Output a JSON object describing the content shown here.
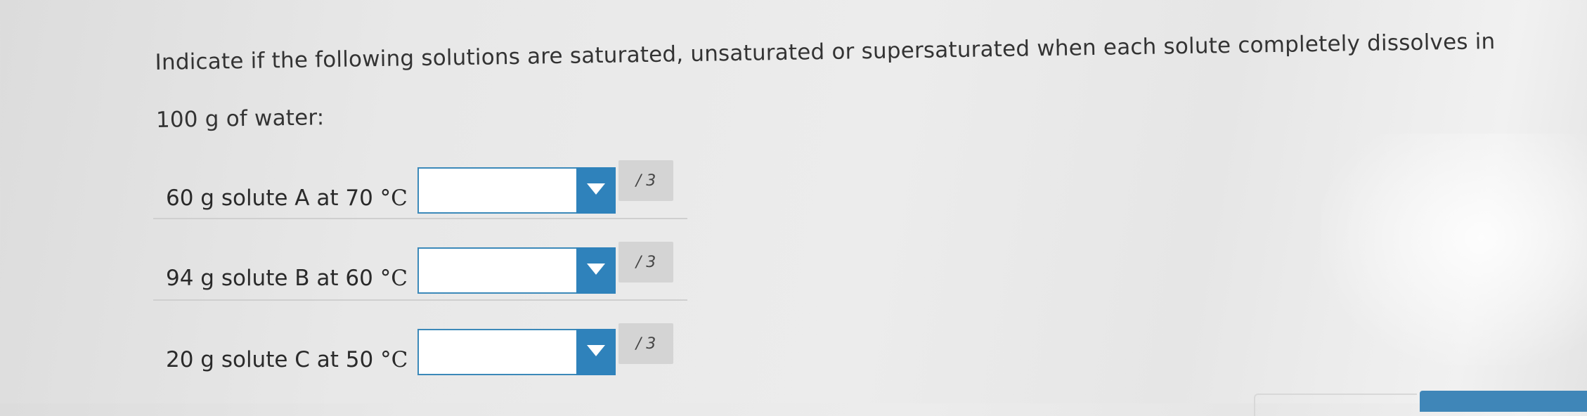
{
  "question": {
    "text": "Indicate if the following solutions are saturated, unsaturated or supersaturated when each solute completely dissolves in 100 g of water:"
  },
  "rows": [
    {
      "label": "60 g solute A at 70 ",
      "unit": "°C",
      "selected": "",
      "points": "/ 3"
    },
    {
      "label": "94 g solute B at 60 ",
      "unit": "°C",
      "selected": "",
      "points": "/ 3"
    },
    {
      "label": "20 g solute C at 50 ",
      "unit": "°C",
      "selected": "",
      "points": "/ 3"
    }
  ],
  "colors": {
    "accent": "#2f82bb",
    "border": "#3c89b9",
    "points_bg": "#d4d4d4"
  },
  "icons": {
    "dropdown": "caret-down-icon"
  }
}
